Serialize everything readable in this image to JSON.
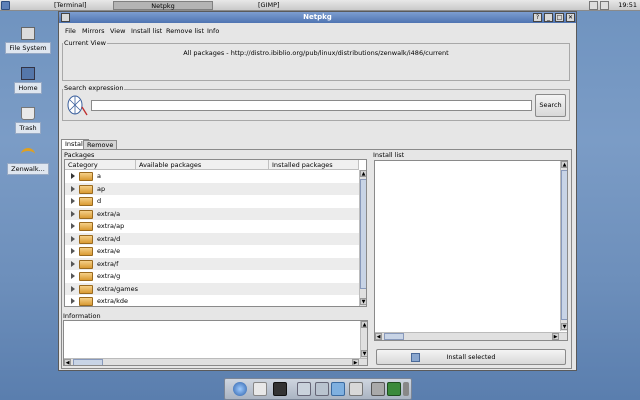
{
  "taskbar": {
    "tasks": [
      "[Terminal]",
      "Netpkg",
      "[GIMP]"
    ],
    "clock": "19:51"
  },
  "desktop": {
    "icons": [
      "File System",
      "Home",
      "Trash",
      "Zenwalk..."
    ]
  },
  "window": {
    "title": "Netpkg",
    "controls": [
      "?",
      "_",
      "□",
      "✕"
    ],
    "menu": [
      "File",
      "Mirrors",
      "View",
      "Install list",
      "Remove list",
      "Info"
    ],
    "current_view": {
      "label": "Current View",
      "text": "All packages - http://distro.ibiblio.org/pub/linux/distributions/zenwalk/i486/current"
    },
    "search": {
      "label": "Search expression",
      "value": "",
      "button": "Search"
    },
    "tabs": [
      "Install",
      "Remove"
    ],
    "packages": {
      "label": "Packages",
      "columns": [
        "Category",
        "Available packages",
        "Installed packages"
      ],
      "rows": [
        "a",
        "ap",
        "d",
        "extra/a",
        "extra/ap",
        "extra/d",
        "extra/e",
        "extra/f",
        "extra/g",
        "extra/games",
        "extra/kde"
      ]
    },
    "information": {
      "label": "Information"
    },
    "install_list": {
      "label": "Install list",
      "button": "Install selected"
    }
  },
  "colors": {
    "desktop": "#7b9cc6",
    "titlebar": "#5f84c0",
    "window_bg": "#e6e6e6"
  }
}
